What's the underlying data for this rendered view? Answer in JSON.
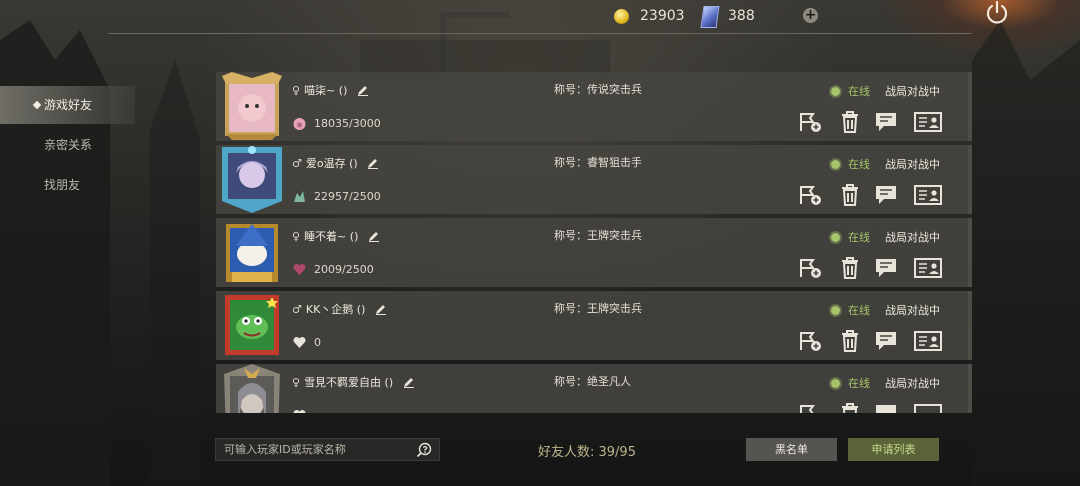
{
  "currency": {
    "coins": "23903",
    "cards": "388"
  },
  "sidebar": {
    "items": [
      {
        "label": "游戏好友",
        "active": true
      },
      {
        "label": "亲密关系",
        "active": false
      },
      {
        "label": "找朋友",
        "active": false
      }
    ]
  },
  "friends": [
    {
      "gender": "♀",
      "name": "喵柒~ ()",
      "points": "18035/3000",
      "title": "称号：传说突击兵",
      "status": "在线",
      "activity": "战局对战中",
      "points_icon": "pig-icon"
    },
    {
      "gender": "♂",
      "name": "爱o温存 ()",
      "points": "22957/2500",
      "title": "称号：睿智狙击手",
      "status": "在线",
      "activity": "战局对战中",
      "points_icon": "dragon-icon"
    },
    {
      "gender": "♀",
      "name": "睡不着~ ()",
      "points": "2009/2500",
      "title": "称号：王牌突击兵",
      "status": "在线",
      "activity": "战局对战中",
      "points_icon": "heart-icon"
    },
    {
      "gender": "♂",
      "name": "KK丶企鹅 ()",
      "points": "0",
      "title": "称号：王牌突击兵",
      "status": "在线",
      "activity": "战局对战中",
      "points_icon": "heart-outline-icon"
    },
    {
      "gender": "♀",
      "name": "雪見不羁爱自由 ()",
      "points": "",
      "title": "称号：绝圣凡人",
      "status": "在线",
      "activity": "战局对战中",
      "points_icon": "heart-outline-icon"
    }
  ],
  "footer": {
    "search_placeholder": "可输入玩家ID或玩家名称",
    "friend_count": "好友人数:  39/95",
    "blacklist_label": "黑名单",
    "requests_label": "申请列表"
  },
  "colors": {
    "online": "#a8c76a",
    "coin": "#e1b420",
    "accent_green": "#5a6438"
  }
}
